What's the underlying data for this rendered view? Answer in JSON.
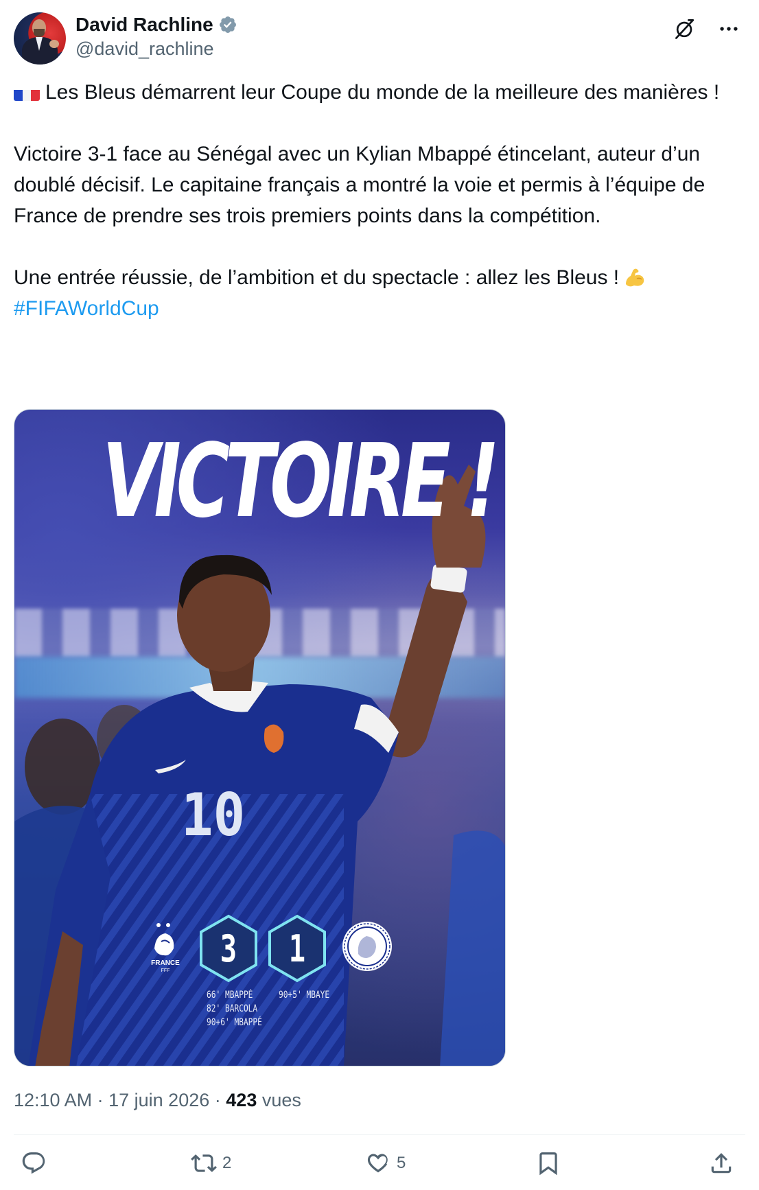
{
  "author": {
    "display_name": "David Rachline",
    "handle": "@david_rachline",
    "verified": true
  },
  "header_icons": [
    "grok-icon",
    "more-icon"
  ],
  "tweet": {
    "para1": "Les Bleus démarrent leur Coupe du monde de la meilleure des manières !",
    "para2": "Victoire 3-1 face au Sénégal avec un Kylian Mbappé étincelant, auteur d’un doublé décisif. Le capitaine français a montré la voie et permis à l’équipe de France de prendre ses trois premiers points dans la compétition.",
    "para3": "Une entrée réussie, de l’ambition et du spectacle : allez les Bleus !",
    "hashtag": "#FIFAWorldCup",
    "emoji_flag": "flag-france-icon",
    "emoji_muscle": "flexed-biceps-icon"
  },
  "media": {
    "headline": "VICTOIRE !",
    "jersey_number": "10",
    "home_team": "FRANCE",
    "home_team_sub": "FFF",
    "home_score": "3",
    "away_score": "1",
    "home_scorers": [
      "66' MBAPPÉ",
      "82' BARCOLA",
      "90+6' MBAPPÉ"
    ],
    "away_scorers": [
      "90+5' MBAYE"
    ]
  },
  "meta": {
    "time": "12:10 AM",
    "dot": "·",
    "date": "17 juin 2026",
    "views_count": "423",
    "views_label": "vues"
  },
  "actions": {
    "reply_count": "",
    "retweet_count": "2",
    "like_count": "5"
  },
  "colors": {
    "accent": "#1d9bf0",
    "text_primary": "#0f1419",
    "text_secondary": "#536471",
    "divider": "#eff3f4"
  }
}
